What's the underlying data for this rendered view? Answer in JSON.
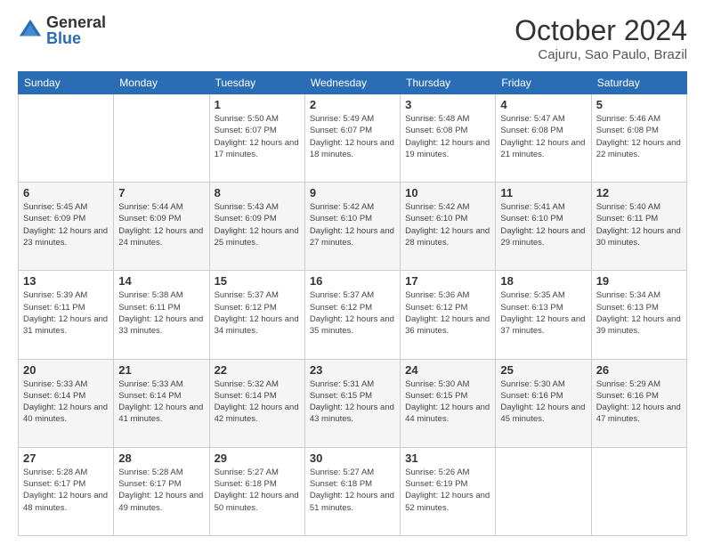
{
  "logo": {
    "general": "General",
    "blue": "Blue"
  },
  "header": {
    "month": "October 2024",
    "location": "Cajuru, Sao Paulo, Brazil"
  },
  "weekdays": [
    "Sunday",
    "Monday",
    "Tuesday",
    "Wednesday",
    "Thursday",
    "Friday",
    "Saturday"
  ],
  "weeks": [
    [
      {
        "day": "",
        "sunrise": "",
        "sunset": "",
        "daylight": ""
      },
      {
        "day": "",
        "sunrise": "",
        "sunset": "",
        "daylight": ""
      },
      {
        "day": "1",
        "sunrise": "Sunrise: 5:50 AM",
        "sunset": "Sunset: 6:07 PM",
        "daylight": "Daylight: 12 hours and 17 minutes."
      },
      {
        "day": "2",
        "sunrise": "Sunrise: 5:49 AM",
        "sunset": "Sunset: 6:07 PM",
        "daylight": "Daylight: 12 hours and 18 minutes."
      },
      {
        "day": "3",
        "sunrise": "Sunrise: 5:48 AM",
        "sunset": "Sunset: 6:08 PM",
        "daylight": "Daylight: 12 hours and 19 minutes."
      },
      {
        "day": "4",
        "sunrise": "Sunrise: 5:47 AM",
        "sunset": "Sunset: 6:08 PM",
        "daylight": "Daylight: 12 hours and 21 minutes."
      },
      {
        "day": "5",
        "sunrise": "Sunrise: 5:46 AM",
        "sunset": "Sunset: 6:08 PM",
        "daylight": "Daylight: 12 hours and 22 minutes."
      }
    ],
    [
      {
        "day": "6",
        "sunrise": "Sunrise: 5:45 AM",
        "sunset": "Sunset: 6:09 PM",
        "daylight": "Daylight: 12 hours and 23 minutes."
      },
      {
        "day": "7",
        "sunrise": "Sunrise: 5:44 AM",
        "sunset": "Sunset: 6:09 PM",
        "daylight": "Daylight: 12 hours and 24 minutes."
      },
      {
        "day": "8",
        "sunrise": "Sunrise: 5:43 AM",
        "sunset": "Sunset: 6:09 PM",
        "daylight": "Daylight: 12 hours and 25 minutes."
      },
      {
        "day": "9",
        "sunrise": "Sunrise: 5:42 AM",
        "sunset": "Sunset: 6:10 PM",
        "daylight": "Daylight: 12 hours and 27 minutes."
      },
      {
        "day": "10",
        "sunrise": "Sunrise: 5:42 AM",
        "sunset": "Sunset: 6:10 PM",
        "daylight": "Daylight: 12 hours and 28 minutes."
      },
      {
        "day": "11",
        "sunrise": "Sunrise: 5:41 AM",
        "sunset": "Sunset: 6:10 PM",
        "daylight": "Daylight: 12 hours and 29 minutes."
      },
      {
        "day": "12",
        "sunrise": "Sunrise: 5:40 AM",
        "sunset": "Sunset: 6:11 PM",
        "daylight": "Daylight: 12 hours and 30 minutes."
      }
    ],
    [
      {
        "day": "13",
        "sunrise": "Sunrise: 5:39 AM",
        "sunset": "Sunset: 6:11 PM",
        "daylight": "Daylight: 12 hours and 31 minutes."
      },
      {
        "day": "14",
        "sunrise": "Sunrise: 5:38 AM",
        "sunset": "Sunset: 6:11 PM",
        "daylight": "Daylight: 12 hours and 33 minutes."
      },
      {
        "day": "15",
        "sunrise": "Sunrise: 5:37 AM",
        "sunset": "Sunset: 6:12 PM",
        "daylight": "Daylight: 12 hours and 34 minutes."
      },
      {
        "day": "16",
        "sunrise": "Sunrise: 5:37 AM",
        "sunset": "Sunset: 6:12 PM",
        "daylight": "Daylight: 12 hours and 35 minutes."
      },
      {
        "day": "17",
        "sunrise": "Sunrise: 5:36 AM",
        "sunset": "Sunset: 6:12 PM",
        "daylight": "Daylight: 12 hours and 36 minutes."
      },
      {
        "day": "18",
        "sunrise": "Sunrise: 5:35 AM",
        "sunset": "Sunset: 6:13 PM",
        "daylight": "Daylight: 12 hours and 37 minutes."
      },
      {
        "day": "19",
        "sunrise": "Sunrise: 5:34 AM",
        "sunset": "Sunset: 6:13 PM",
        "daylight": "Daylight: 12 hours and 39 minutes."
      }
    ],
    [
      {
        "day": "20",
        "sunrise": "Sunrise: 5:33 AM",
        "sunset": "Sunset: 6:14 PM",
        "daylight": "Daylight: 12 hours and 40 minutes."
      },
      {
        "day": "21",
        "sunrise": "Sunrise: 5:33 AM",
        "sunset": "Sunset: 6:14 PM",
        "daylight": "Daylight: 12 hours and 41 minutes."
      },
      {
        "day": "22",
        "sunrise": "Sunrise: 5:32 AM",
        "sunset": "Sunset: 6:14 PM",
        "daylight": "Daylight: 12 hours and 42 minutes."
      },
      {
        "day": "23",
        "sunrise": "Sunrise: 5:31 AM",
        "sunset": "Sunset: 6:15 PM",
        "daylight": "Daylight: 12 hours and 43 minutes."
      },
      {
        "day": "24",
        "sunrise": "Sunrise: 5:30 AM",
        "sunset": "Sunset: 6:15 PM",
        "daylight": "Daylight: 12 hours and 44 minutes."
      },
      {
        "day": "25",
        "sunrise": "Sunrise: 5:30 AM",
        "sunset": "Sunset: 6:16 PM",
        "daylight": "Daylight: 12 hours and 45 minutes."
      },
      {
        "day": "26",
        "sunrise": "Sunrise: 5:29 AM",
        "sunset": "Sunset: 6:16 PM",
        "daylight": "Daylight: 12 hours and 47 minutes."
      }
    ],
    [
      {
        "day": "27",
        "sunrise": "Sunrise: 5:28 AM",
        "sunset": "Sunset: 6:17 PM",
        "daylight": "Daylight: 12 hours and 48 minutes."
      },
      {
        "day": "28",
        "sunrise": "Sunrise: 5:28 AM",
        "sunset": "Sunset: 6:17 PM",
        "daylight": "Daylight: 12 hours and 49 minutes."
      },
      {
        "day": "29",
        "sunrise": "Sunrise: 5:27 AM",
        "sunset": "Sunset: 6:18 PM",
        "daylight": "Daylight: 12 hours and 50 minutes."
      },
      {
        "day": "30",
        "sunrise": "Sunrise: 5:27 AM",
        "sunset": "Sunset: 6:18 PM",
        "daylight": "Daylight: 12 hours and 51 minutes."
      },
      {
        "day": "31",
        "sunrise": "Sunrise: 5:26 AM",
        "sunset": "Sunset: 6:19 PM",
        "daylight": "Daylight: 12 hours and 52 minutes."
      },
      {
        "day": "",
        "sunrise": "",
        "sunset": "",
        "daylight": ""
      },
      {
        "day": "",
        "sunrise": "",
        "sunset": "",
        "daylight": ""
      }
    ]
  ]
}
